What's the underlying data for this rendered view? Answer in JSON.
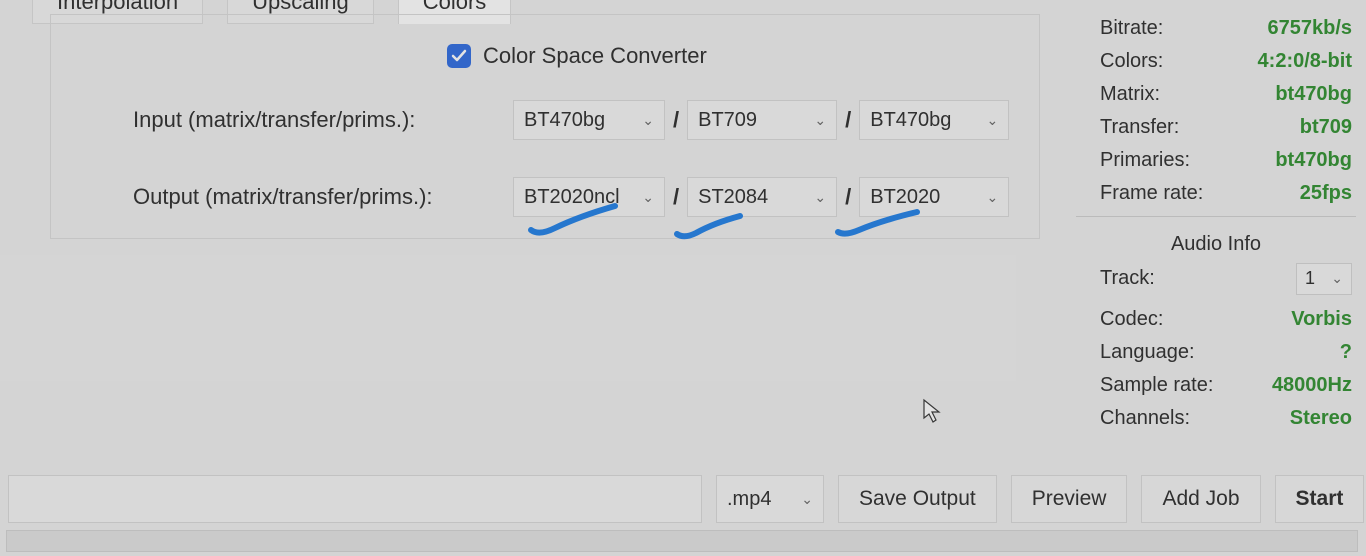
{
  "tabs": {
    "t1": "Interpolation",
    "t2": "Upscaling",
    "t3": "Colors"
  },
  "panel": {
    "checkbox_label": "Color Space Converter",
    "input_label": "Input (matrix/transfer/prims.):",
    "output_label": "Output (matrix/transfer/prims.):",
    "input": {
      "matrix": "BT470bg",
      "transfer": "BT709",
      "prims": "BT470bg"
    },
    "output": {
      "matrix": "BT2020ncl",
      "transfer": "ST2084",
      "prims": "BT2020"
    },
    "sep": "/"
  },
  "video_info": {
    "bitrate": {
      "label": "Bitrate:",
      "value": "6757kb/s"
    },
    "colors": {
      "label": "Colors:",
      "value": "4:2:0/8-bit"
    },
    "matrix": {
      "label": "Matrix:",
      "value": "bt470bg"
    },
    "transfer": {
      "label": "Transfer:",
      "value": "bt709"
    },
    "primaries": {
      "label": "Primaries:",
      "value": "bt470bg"
    },
    "framerate": {
      "label": "Frame rate:",
      "value": "25fps"
    }
  },
  "audio_heading": "Audio Info",
  "audio_info": {
    "track": {
      "label": "Track:",
      "value": "1"
    },
    "codec": {
      "label": "Codec:",
      "value": "Vorbis"
    },
    "language": {
      "label": "Language:",
      "value": "?"
    },
    "samplerate": {
      "label": "Sample rate:",
      "value": "48000Hz"
    },
    "channels": {
      "label": "Channels:",
      "value": "Stereo"
    }
  },
  "bottom": {
    "ext": ".mp4",
    "save": "Save Output",
    "preview": "Preview",
    "addjob": "Add Job",
    "start": "Start"
  }
}
